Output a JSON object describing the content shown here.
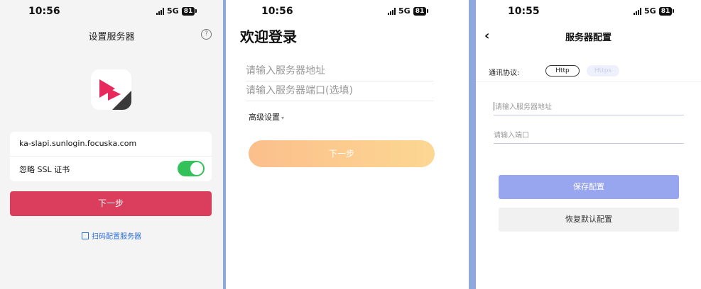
{
  "status_bars": [
    {
      "time": "10:56",
      "network": "5G",
      "battery": "81"
    },
    {
      "time": "10:56",
      "network": "5G",
      "battery": "81"
    },
    {
      "time": "10:55",
      "network": "5G",
      "battery": "81"
    }
  ],
  "screen1": {
    "title": "设置服务器",
    "help_glyph": "?",
    "server_address": "ka-slapi.sunlogin.focuska.com",
    "ssl_label": "忽略 SSL 证书",
    "ssl_ignored": true,
    "next_label": "下一步",
    "scan_label": "扫码配置服务器",
    "accent": "#db3e5c"
  },
  "screen2": {
    "title": "欢迎登录",
    "server_placeholder": "请输入服务器地址",
    "port_placeholder": "请输入服务器端口(选填)",
    "advanced_label": "高级设置",
    "next_label": "下一步"
  },
  "screen3": {
    "title": "服务器配置",
    "protocol_label": "通讯协议:",
    "protocol_options": [
      "Http",
      "Https"
    ],
    "protocol_selected": "Http",
    "address_placeholder": "请输入服务器地址",
    "port_placeholder": "请输入端口",
    "save_label": "保存配置",
    "restore_label": "恢复默认配置",
    "accent": "#98a6f0"
  }
}
